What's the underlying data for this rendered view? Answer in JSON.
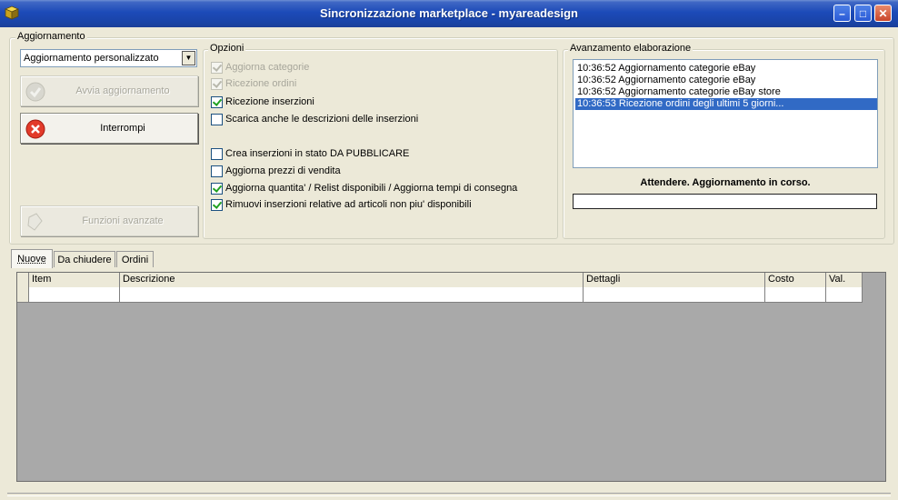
{
  "window": {
    "title": "Sincronizzazione marketplace - myareadesign",
    "minimize": "–",
    "maximize": "□",
    "close": "✕",
    "icon": "app-cube-icon"
  },
  "aggiornamento": {
    "legend": "Aggiornamento",
    "mode_select": "Aggiornamento personalizzato",
    "avvia_label": "Avvia aggiornamento",
    "interrompi_label": "Interrompi",
    "funzioni_label": "Funzioni avanzate"
  },
  "opzioni": {
    "legend": "Opzioni",
    "items": [
      {
        "label": "Aggiorna categorie",
        "checked": true,
        "disabled": true
      },
      {
        "label": "Ricezione ordini",
        "checked": true,
        "disabled": true
      },
      {
        "label": "Ricezione inserzioni",
        "checked": true,
        "disabled": false
      },
      {
        "label": "Scarica anche le descrizioni delle inserzioni",
        "checked": false,
        "disabled": false
      },
      {
        "label": "Crea inserzioni in stato DA PUBBLICARE",
        "checked": false,
        "disabled": false
      },
      {
        "label": "Aggiorna prezzi di vendita",
        "checked": false,
        "disabled": false
      },
      {
        "label": "Aggiorna quantita' / Relist disponibili / Aggiorna tempi di consegna",
        "checked": true,
        "disabled": false
      },
      {
        "label": "Rimuovi inserzioni relative ad articoli non piu' disponibili",
        "checked": true,
        "disabled": false
      }
    ]
  },
  "avanzamento": {
    "legend": "Avanzamento elaborazione",
    "log": [
      {
        "text": "10:36:52 Aggiornamento categorie eBay",
        "selected": false
      },
      {
        "text": "10:36:52 Aggiornamento categorie eBay",
        "selected": false
      },
      {
        "text": "10:36:52 Aggiornamento categorie eBay store",
        "selected": false
      },
      {
        "text": "10:36:53 Ricezione ordini degli ultimi 5 giorni...",
        "selected": true
      }
    ],
    "status": "Attendere. Aggiornamento in corso.",
    "progress": 0
  },
  "tabs": [
    {
      "label": "Nuove",
      "active": true
    },
    {
      "label": "Da chiudere",
      "active": false
    },
    {
      "label": "Ordini",
      "active": false
    }
  ],
  "grid": {
    "columns": [
      "Item",
      "Descrizione",
      "Dettagli",
      "Costo",
      "Val."
    ]
  },
  "colors": {
    "titlebar": "#1c4ab8",
    "selection": "#316ac5",
    "check": "#21a121"
  }
}
